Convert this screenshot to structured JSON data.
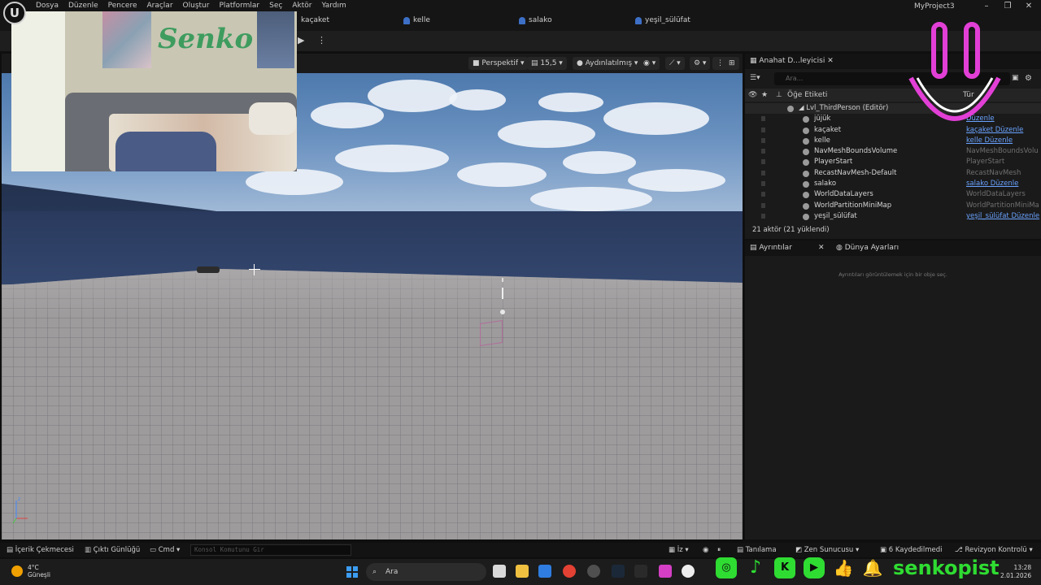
{
  "menubar": {
    "items": [
      "Dosya",
      "Düzenle",
      "Pencere",
      "Araçlar",
      "Oluştur",
      "Platformlar",
      "Seç",
      "Aktör",
      "Yardım"
    ],
    "project": "MyProject3"
  },
  "tabs": [
    "kaçaket",
    "kelle",
    "salako",
    "yeşil_sülüfat"
  ],
  "viewport": {
    "perspective": "Perspektif",
    "fov": "15,5",
    "lighting": "Aydınlatılmış"
  },
  "outliner": {
    "tab_label": "Anahat D...leyicisi",
    "search_placeholder": "Ara...",
    "col_label": "Öğe Etiketi",
    "col_type": "Tür",
    "root_label": "Lvl_ThirdPerson (Editör)",
    "rows": [
      {
        "name": "jüjük",
        "type": "Düzenle"
      },
      {
        "name": "kaçaket",
        "type": "kaçaket Düzenle"
      },
      {
        "name": "kelle",
        "type": "kelle Düzenle"
      },
      {
        "name": "NavMeshBoundsVolume",
        "type": "NavMeshBoundsVolu"
      },
      {
        "name": "PlayerStart",
        "type": "PlayerStart"
      },
      {
        "name": "RecastNavMesh-Default",
        "type": "RecastNavMesh"
      },
      {
        "name": "salako",
        "type": "salako Düzenle"
      },
      {
        "name": "WorldDataLayers",
        "type": "WorldDataLayers"
      },
      {
        "name": "WorldPartitionMiniMap",
        "type": "WorldPartitionMiniMa"
      },
      {
        "name": "yeşil_sülüfat",
        "type": "yeşil_sülüfat Düzenle"
      }
    ],
    "actor_count": "21 aktör (21 yüklendi)"
  },
  "details": {
    "tab_details": "Ayrıntılar",
    "tab_world": "Dünya Ayarları",
    "empty_text": "Ayrıntıları görüntülemek için bir obje seç."
  },
  "statusbar": {
    "content_drawer": "İçerik Çekmecesi",
    "output_log": "Çıktı Günlüğü",
    "cmd": "Cmd",
    "console_placeholder": "Konsol Komutunu Gir",
    "trace": "İz",
    "diagnostics": "Tanılama",
    "zen": "Zen Sunucusu",
    "saved": "6 Kaydedilmedi",
    "revision": "Revizyon Kontrolü"
  },
  "taskbar": {
    "temp": "4°C",
    "weather": "Güneşli",
    "search": "Ara",
    "time": "13:28",
    "date": "2.01.2026",
    "brand": "senkopist"
  },
  "webcam": {
    "graffiti": "Senko"
  },
  "colors": {
    "accent_link": "#6aa3ff",
    "social_green": "#2fdc32",
    "smiley_pink": "#e23fd6"
  }
}
